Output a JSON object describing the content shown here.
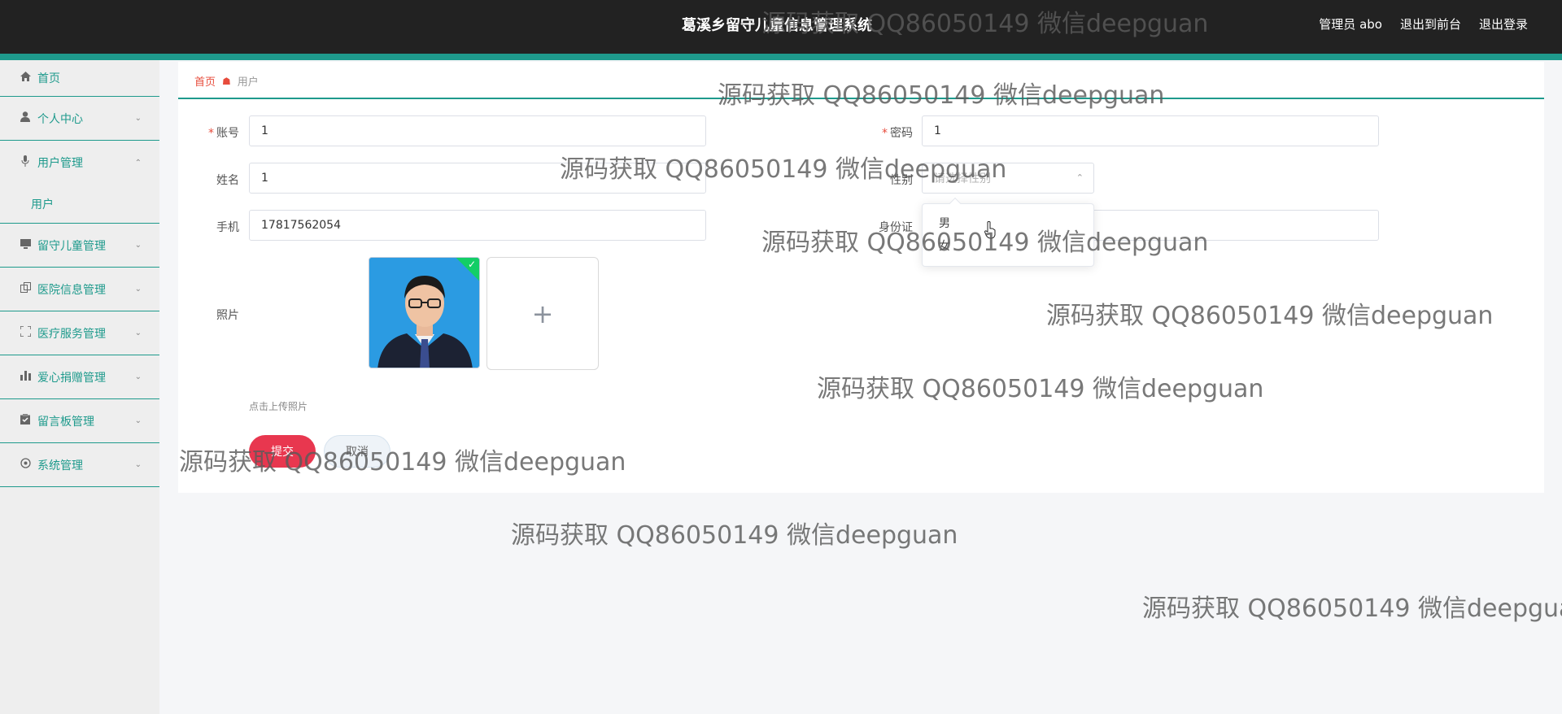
{
  "header": {
    "title": "葛溪乡留守儿童信息管理系统",
    "admin_label": "管理员 abo",
    "front_label": "退出到前台",
    "logout_label": "退出登录"
  },
  "sidebar": {
    "items": [
      {
        "label": "首页",
        "icon": "home-icon"
      },
      {
        "label": "个人中心",
        "icon": "user-icon"
      },
      {
        "label": "用户管理",
        "icon": "mic-icon"
      },
      {
        "label": "用户",
        "icon": ""
      },
      {
        "label": "留守儿童管理",
        "icon": "monitor-icon"
      },
      {
        "label": "医院信息管理",
        "icon": "copy-icon"
      },
      {
        "label": "医疗服务管理",
        "icon": "fullscreen-icon"
      },
      {
        "label": "爱心捐赠管理",
        "icon": "bar-chart-icon"
      },
      {
        "label": "留言板管理",
        "icon": "clipboard-icon"
      },
      {
        "label": "系统管理",
        "icon": "settings-icon"
      }
    ]
  },
  "breadcrumb": {
    "home": "首页",
    "current": "用户"
  },
  "form": {
    "account_label": "账号",
    "account_value": "1",
    "password_label": "密码",
    "password_value": "1",
    "name_label": "姓名",
    "name_value": "1",
    "gender_label": "性别",
    "gender_placeholder": "请选择性别",
    "phone_label": "手机",
    "phone_value": "17817562054",
    "id_label": "身份证",
    "photo_label": "照片",
    "upload_tip": "点击上传照片",
    "submit_label": "提交",
    "cancel_label": "取消"
  },
  "gender_options": [
    "男",
    "女"
  ],
  "watermark": "源码获取 QQ86050149 微信deepguan",
  "colors": {
    "accent": "#1e9a8c",
    "topbar": "#222222",
    "submit": "#e8374f"
  }
}
